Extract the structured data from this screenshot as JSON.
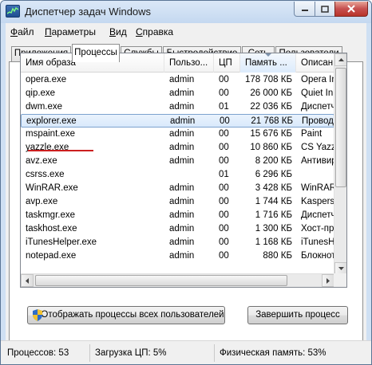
{
  "window": {
    "title": "Диспетчер задач Windows",
    "icon": "taskmgr-app-icon",
    "buttons": {
      "minimize": "minimize-icon",
      "maximize": "maximize-icon",
      "close": "close-icon"
    }
  },
  "menu": [
    {
      "label": "Файл",
      "accel": "Ф",
      "rest": "айл"
    },
    {
      "label": "Параметры",
      "accel": "П",
      "rest": "араметры"
    },
    {
      "label": "Вид",
      "accel": "В",
      "rest": "ид"
    },
    {
      "label": "Справка",
      "accel": "С",
      "rest": "правка"
    }
  ],
  "tabs": [
    "Приложения",
    "Процессы",
    "Службы",
    "Быстродействие",
    "Сеть",
    "Пользователи"
  ],
  "active_tab": "Процессы",
  "table": {
    "columns": [
      "Имя образа",
      "Пользо...",
      "ЦП",
      "Память ...",
      "Описан"
    ],
    "sorted_column": "Память ...",
    "selected_row": "explorer.exe",
    "rows": [
      [
        "opera.exe",
        "admin",
        "00",
        "178 708 КБ",
        "Opera In"
      ],
      [
        "qip.exe",
        "admin",
        "00",
        "26 000 КБ",
        "Quiet In"
      ],
      [
        "dwm.exe",
        "admin",
        "01",
        "22 036 КБ",
        "Диспетч"
      ],
      [
        "explorer.exe",
        "admin",
        "00",
        "21 768 КБ",
        "Проводн"
      ],
      [
        "mspaint.exe",
        "admin",
        "00",
        "15 676 КБ",
        "Paint"
      ],
      [
        "yazzle.exe",
        "admin",
        "00",
        "10 860 КБ",
        "CS Yazzl"
      ],
      [
        "avz.exe",
        "admin",
        "00",
        "8 200 КБ",
        "Антивир"
      ],
      [
        "csrss.exe",
        "",
        "01",
        "6 296 КБ",
        ""
      ],
      [
        "WinRAR.exe",
        "admin",
        "00",
        "3 428 КБ",
        "WinRAR a"
      ],
      [
        "avp.exe",
        "admin",
        "00",
        "1 744 КБ",
        "Kaspersk"
      ],
      [
        "taskmgr.exe",
        "admin",
        "00",
        "1 716 КБ",
        "Диспетч"
      ],
      [
        "taskhost.exe",
        "admin",
        "00",
        "1 300 КБ",
        "Хост-пр"
      ],
      [
        "iTunesHelper.exe",
        "admin",
        "00",
        "1 168 КБ",
        "iTunesH"
      ],
      [
        "notepad.exe",
        "admin",
        "00",
        "880 КБ",
        "Блокнот"
      ]
    ]
  },
  "buttons": {
    "show_all": "Отображать процессы всех пользователей",
    "end_process": "Завершить процесс"
  },
  "status": {
    "processes": "Процессов: 53",
    "cpu": "Загрузка ЦП: 5%",
    "memory": "Физическая память: 53%"
  },
  "colors": {
    "selection": "#d9e9fb",
    "annotation_underline": "#cc1f1f"
  }
}
